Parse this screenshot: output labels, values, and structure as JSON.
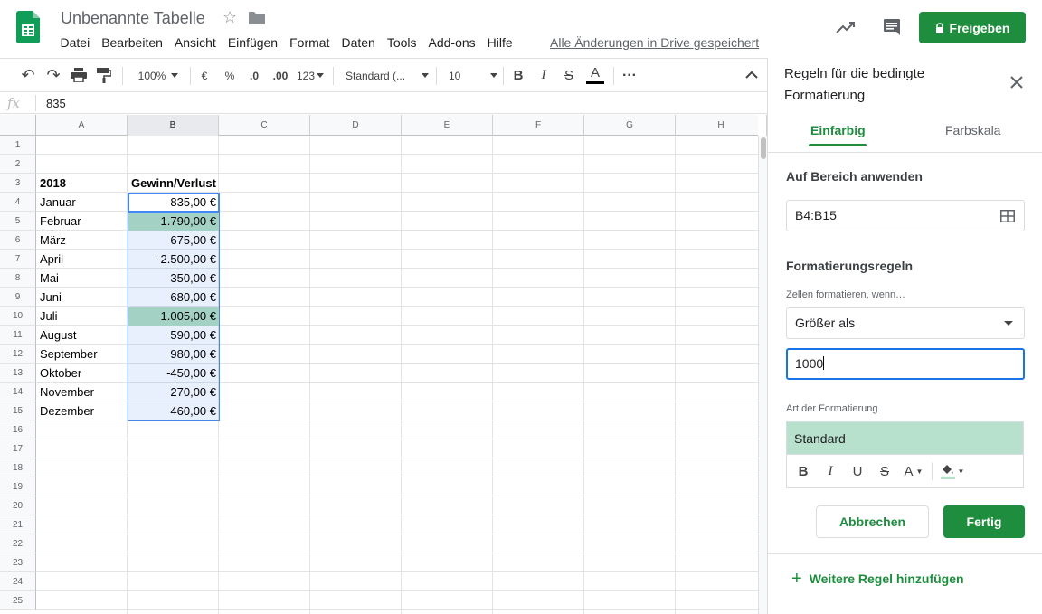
{
  "header": {
    "doc_title": "Unbenannte Tabelle",
    "menu": [
      "Datei",
      "Bearbeiten",
      "Ansicht",
      "Einfügen",
      "Format",
      "Daten",
      "Tools",
      "Add-ons",
      "Hilfe"
    ],
    "save_status": "Alle Änderungen in Drive gespeichert",
    "share_label": "Freigeben",
    "share_color": "#1e8e3e"
  },
  "toolbar": {
    "zoom": "100%",
    "currency": "€",
    "percent": "%",
    "dec_decrease": ".0",
    "dec_increase": ".00",
    "more_formats": "123",
    "font": "Standard (...",
    "font_size": "10",
    "icons": [
      "undo-icon",
      "redo-icon",
      "print-icon",
      "paint-format-icon",
      "bold-icon",
      "italic-icon",
      "strikethrough-icon",
      "text-color-icon",
      "more-icon",
      "collapse-icon"
    ]
  },
  "formula_bar": {
    "fx": "fx",
    "value": "835"
  },
  "sheet": {
    "columns": [
      "A",
      "B",
      "C",
      "D",
      "E",
      "F",
      "G",
      "H"
    ],
    "rows": [
      "1",
      "2",
      "3",
      "4",
      "5",
      "6",
      "7",
      "8",
      "9",
      "10",
      "11",
      "12",
      "13",
      "14",
      "15",
      "16",
      "17",
      "18",
      "19",
      "20",
      "21",
      "22",
      "23",
      "24",
      "25"
    ],
    "header_a": "2018",
    "header_b": "Gewinn/Verlust",
    "data": [
      {
        "month": "Januar",
        "value": "835,00 €",
        "highlight": false
      },
      {
        "month": "Februar",
        "value": "1.790,00 €",
        "highlight": true
      },
      {
        "month": "März",
        "value": "675,00 €",
        "highlight": false
      },
      {
        "month": "April",
        "value": "-2.500,00 €",
        "highlight": false
      },
      {
        "month": "Mai",
        "value": "350,00 €",
        "highlight": false
      },
      {
        "month": "Juni",
        "value": "680,00 €",
        "highlight": false
      },
      {
        "month": "Juli",
        "value": "1.005,00 €",
        "highlight": true
      },
      {
        "month": "August",
        "value": "590,00 €",
        "highlight": false
      },
      {
        "month": "September",
        "value": "980,00 €",
        "highlight": false
      },
      {
        "month": "Oktober",
        "value": "-450,00 €",
        "highlight": false
      },
      {
        "month": "November",
        "value": "270,00 €",
        "highlight": false
      },
      {
        "month": "Dezember",
        "value": "460,00 €",
        "highlight": false
      }
    ],
    "highlight_color": "#a3d2c4",
    "selection_color": "#4285f4"
  },
  "panel": {
    "title": "Regeln für die bedingte Formatierung",
    "tab_single": "Einfarbig",
    "tab_scale": "Farbskala",
    "apply_label": "Auf Bereich anwenden",
    "range": "B4:B15",
    "rules_label": "Formatierungsregeln",
    "condition_label": "Zellen formatieren, wenn…",
    "condition": "Größer als",
    "condition_value": "1000",
    "format_label": "Art der Formatierung",
    "format_preview": "Standard",
    "format_preview_color": "#b7e1cd",
    "cancel_label": "Abbrechen",
    "done_label": "Fertig",
    "add_rule_label": "Weitere Regel hinzufügen"
  }
}
